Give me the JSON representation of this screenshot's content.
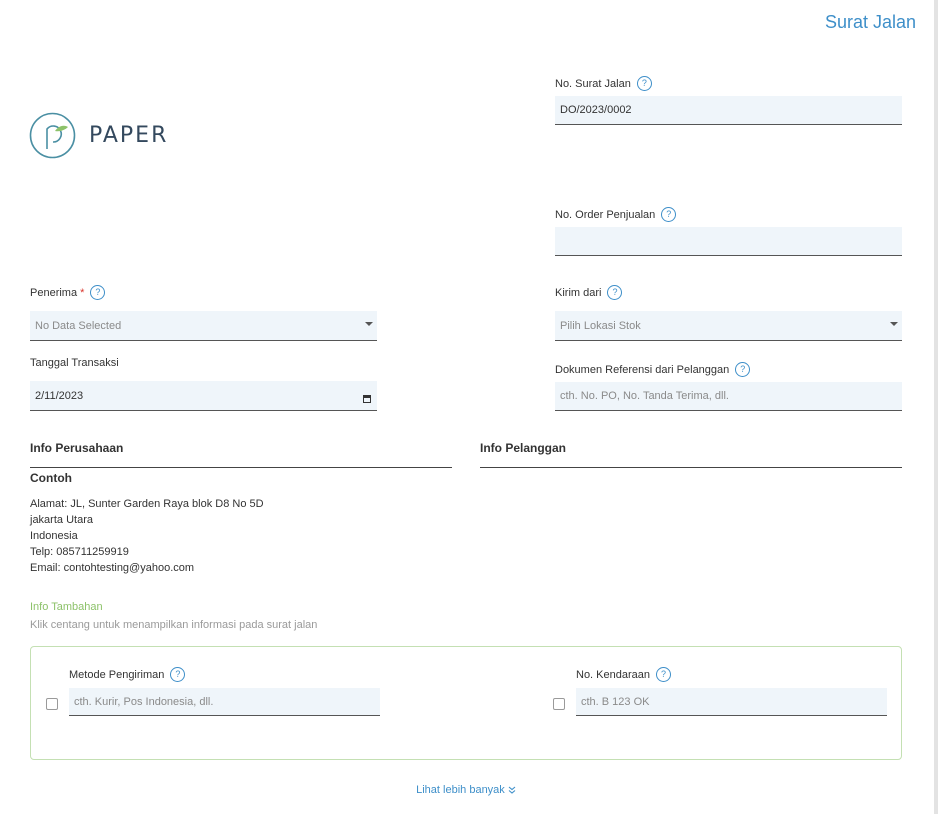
{
  "document": {
    "title": "Surat Jalan"
  },
  "logo": {
    "text": "PAPER"
  },
  "help_glyph": "?",
  "fields": {
    "no_surat_jalan": {
      "label": "No. Surat Jalan",
      "value": "DO/2023/0002"
    },
    "no_order": {
      "label": "No. Order Penjualan",
      "value": ""
    },
    "penerima": {
      "label": "Penerima",
      "required_mark": "*",
      "placeholder": "No Data Selected"
    },
    "kirim_dari": {
      "label": "Kirim dari",
      "placeholder": "Pilih Lokasi Stok"
    },
    "tanggal": {
      "label": "Tanggal Transaksi",
      "value": "2/11/2023"
    },
    "dokumen_ref": {
      "label": "Dokumen Referensi dari Pelanggan",
      "placeholder": "cth. No. PO, No. Tanda Terima, dll."
    }
  },
  "company": {
    "section_title": "Info Perusahaan",
    "name": "Contoh",
    "address": "Alamat: JL, Sunter Garden Raya blok D8 No 5D",
    "city": "jakarta Utara",
    "country": "Indonesia",
    "phone": "Telp: 085711259919",
    "email": "Email: contohtesting@yahoo.com"
  },
  "customer": {
    "section_title": "Info Pelanggan"
  },
  "extra": {
    "title": "Info Tambahan",
    "hint": "Klik centang untuk menampilkan informasi pada surat jalan",
    "metode": {
      "label": "Metode Pengiriman",
      "placeholder": "cth. Kurir, Pos Indonesia, dll."
    },
    "kendaraan": {
      "label": "No. Kendaraan",
      "placeholder": "cth. B 123 OK"
    }
  },
  "more_link": {
    "label": "Lihat lebih banyak",
    "icon": "double-chevron-down-icon"
  },
  "colors": {
    "accent": "#3e8fc9",
    "field_bg": "#eff5fa",
    "green": "#8dc26a",
    "required": "#d9342b"
  }
}
